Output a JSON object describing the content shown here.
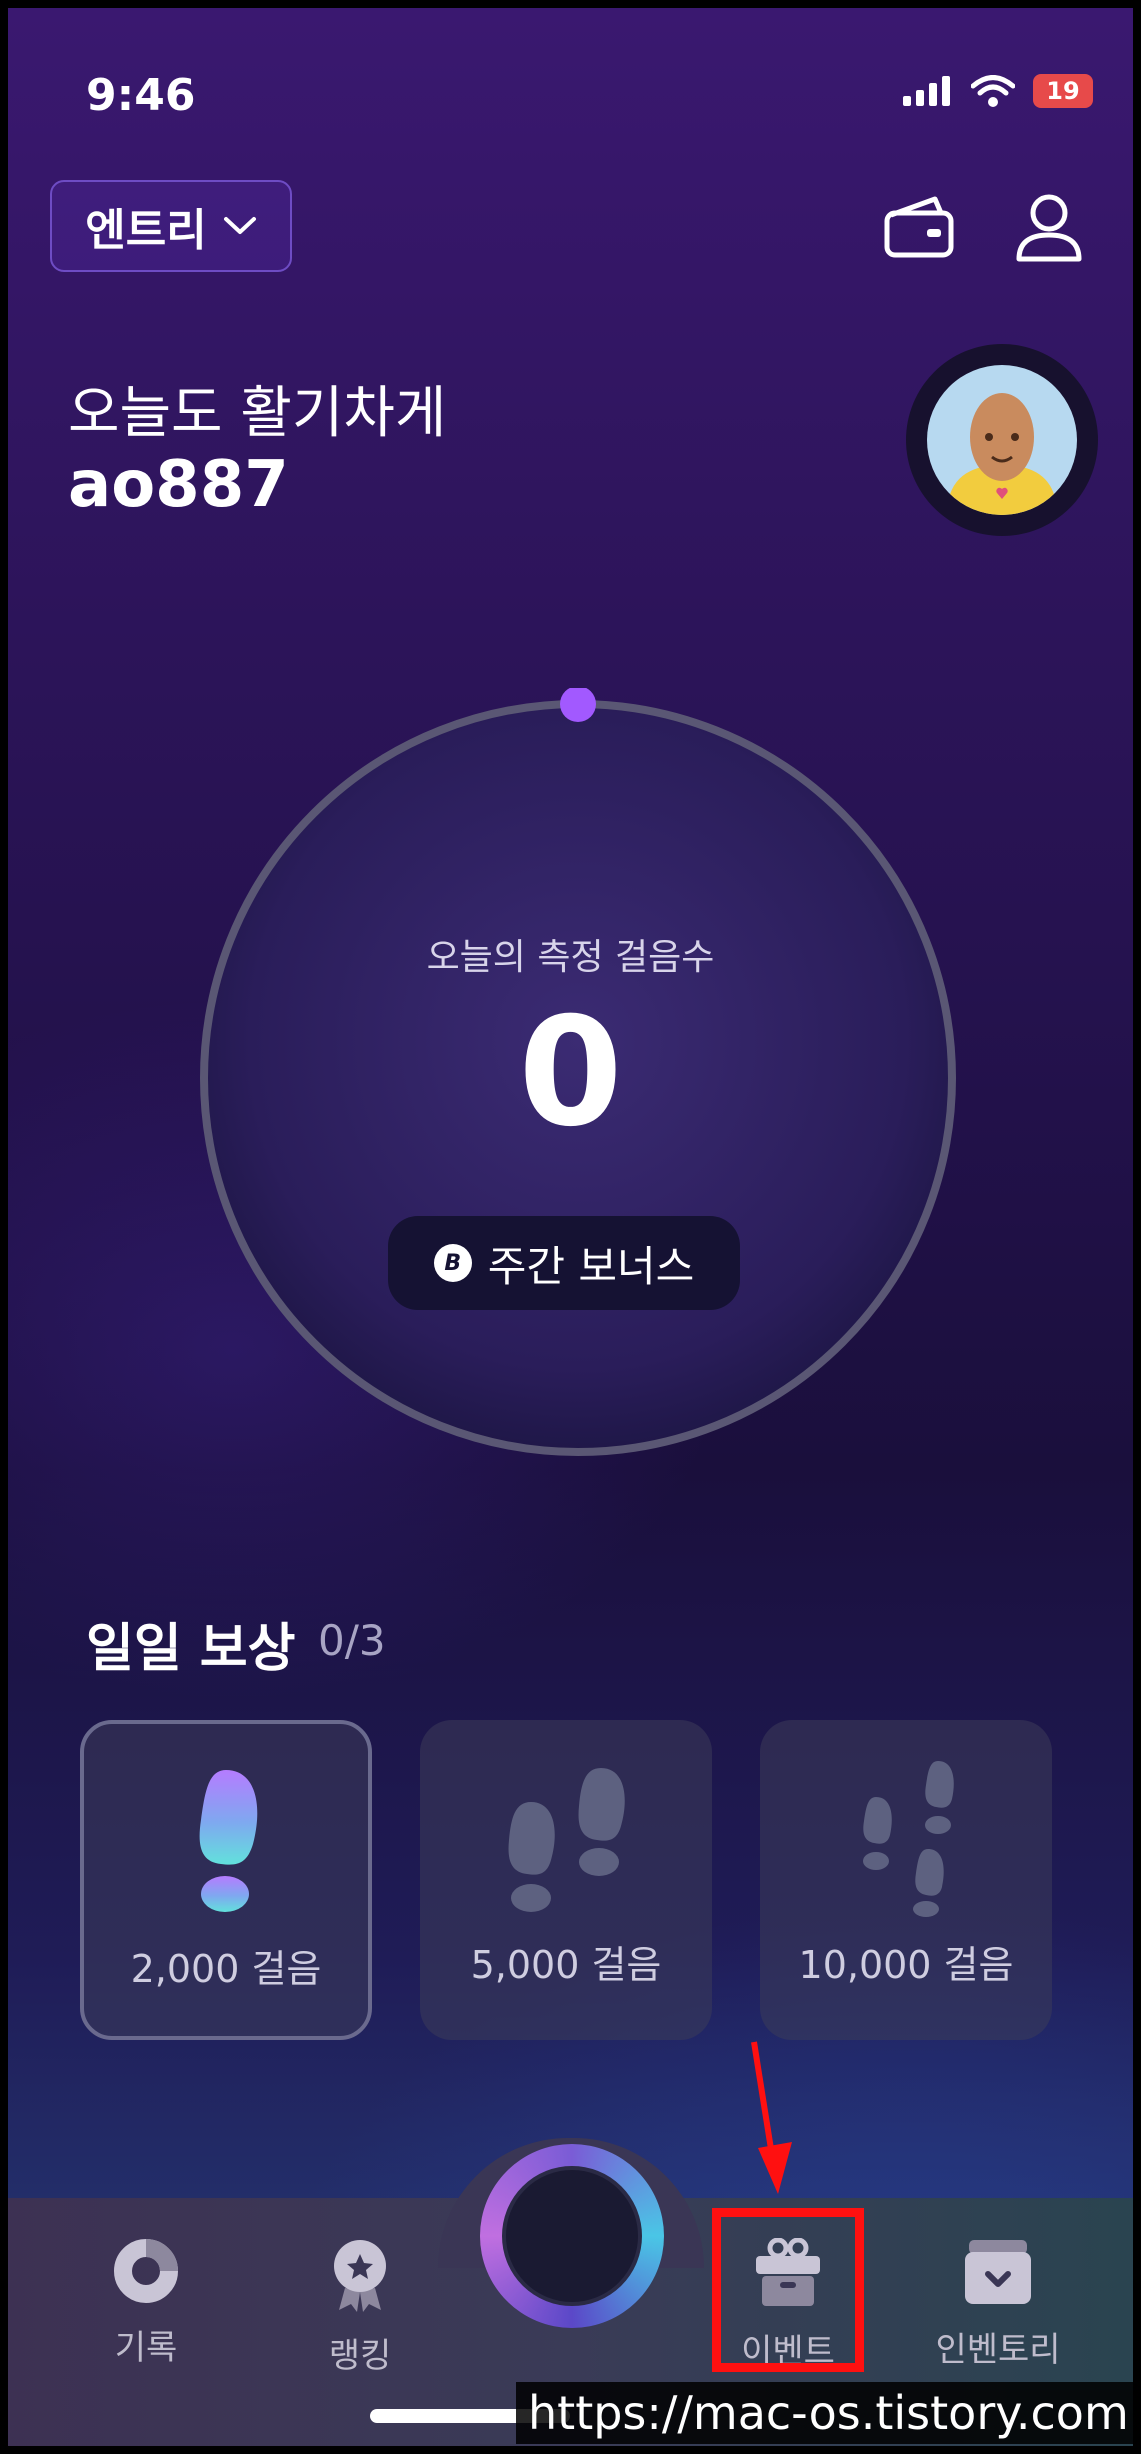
{
  "status_bar": {
    "time": "9:46",
    "battery": "19"
  },
  "header": {
    "league_label": "엔트리",
    "greeting": "오늘도 활기차게",
    "username": "ao887"
  },
  "step_widget": {
    "label": "오늘의 측정 걸음수",
    "count": "0",
    "bonus_label": "주간 보너스",
    "bonus_coin_glyph": "B",
    "progress": 0
  },
  "daily_reward": {
    "title": "일일 보상",
    "progress": "0/3",
    "cards": [
      {
        "label": "2,000 걸음",
        "icon": "single-footprint-icon"
      },
      {
        "label": "5,000 걸음",
        "icon": "two-footprints-icon"
      },
      {
        "label": "10,000 걸음",
        "icon": "three-footprints-icon"
      }
    ]
  },
  "bottom_nav": {
    "items": [
      {
        "label": "기록",
        "icon": "record-donut-icon"
      },
      {
        "label": "랭킹",
        "icon": "ranking-medal-icon"
      },
      {
        "label": "이벤트",
        "icon": "gift-icon"
      },
      {
        "label": "인벤토리",
        "icon": "inventory-box-icon"
      }
    ]
  },
  "watermark": "https://mac-os.tistory.com",
  "colors": {
    "accent": "#a259ff",
    "highlight": "#ff1010"
  }
}
